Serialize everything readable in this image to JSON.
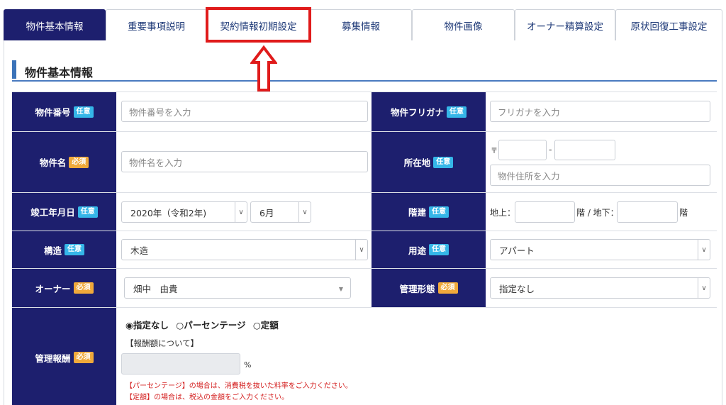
{
  "tabs": [
    {
      "label": "物件基本情報",
      "active": true
    },
    {
      "label": "重要事項説明"
    },
    {
      "label": "契約情報初期設定"
    },
    {
      "label": "募集情報"
    },
    {
      "label": "物件画像"
    },
    {
      "label": "オーナー精算設定"
    },
    {
      "label": "原状回復工事設定"
    }
  ],
  "section": {
    "title": "物件基本情報"
  },
  "badges": {
    "optional": "任意",
    "required": "必須"
  },
  "fields": {
    "property_number": {
      "label": "物件番号",
      "placeholder": "物件番号を入力"
    },
    "property_furigana": {
      "label": "物件フリガナ",
      "placeholder": "フリガナを入力"
    },
    "property_name": {
      "label": "物件名",
      "placeholder": "物件名を入力"
    },
    "address": {
      "label": "所在地",
      "postal_mark": "〒",
      "postal_sep": "-",
      "placeholder": "物件住所を入力"
    },
    "built_date": {
      "label": "竣工年月日",
      "year": "2020年（令和2年)",
      "month": "6月"
    },
    "floors": {
      "label": "階建",
      "above": "地上：",
      "mid": "階 / 地下：",
      "suffix": "階"
    },
    "structure": {
      "label": "構造",
      "value": "木造"
    },
    "usage": {
      "label": "用途",
      "value": "アパート"
    },
    "owner": {
      "label": "オーナー",
      "value": "畑中　由貴"
    },
    "management_type": {
      "label": "管理形態",
      "value": "指定なし"
    },
    "management_fee": {
      "label": "管理報酬",
      "options": [
        "指定なし",
        "パーセンテージ",
        "定額"
      ],
      "selected": "指定なし",
      "about": "【報酬額について】",
      "unit": "%",
      "note1": "【パーセンテージ】の場合は、消費税を抜いた料率をご入力ください。",
      "note2": "【定額】の場合は、税込の金額をご入力ください。"
    }
  },
  "colors": {
    "header_navy": "#1d1f6e",
    "accent_blue": "#3b73b9",
    "highlight_red": "#e01b1b",
    "badge_optional": "#35b6e8",
    "badge_required": "#f0a93b"
  }
}
